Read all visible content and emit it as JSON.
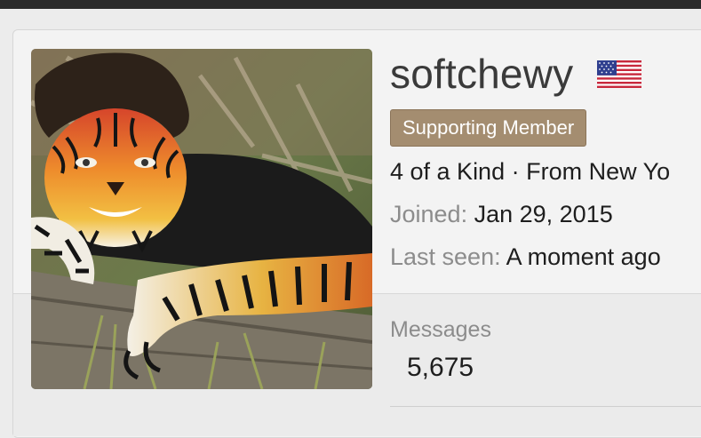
{
  "profile": {
    "username": "softchewy",
    "flag_icon": "us-flag-icon",
    "badge": "Supporting Member",
    "tagline": "4 of a Kind · From New Yo",
    "joined_label": "Joined:",
    "joined_value": "Jan 29, 2015",
    "last_seen_label": "Last seen:",
    "last_seen_value": "A moment ago"
  },
  "stats": {
    "messages_label": "Messages",
    "messages_value": "5,675"
  },
  "colors": {
    "badge_bg": "#a48d70",
    "text_primary": "#3a3a3a",
    "text_muted": "#8c8c8c"
  }
}
